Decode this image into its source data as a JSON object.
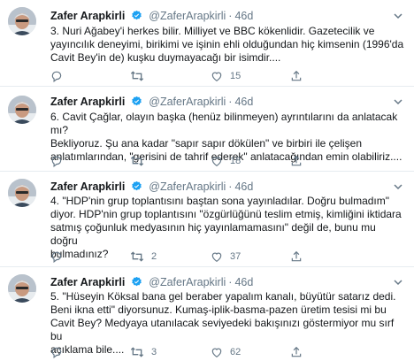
{
  "author": {
    "name": "Zafer Arapkirli",
    "handle": "@ZaferArapkirli",
    "verified": true
  },
  "tweets": [
    {
      "time": "46d",
      "text": "3. Nuri Ağabey'i herkes bilir. Milliyet ve BBC kökenlidir. Gazetecilik ve\nyayıncılık deneyimi, birikimi ve işinin ehli olduğundan hiç kimsenin (1996'da\nCavit Bey'in de) kuşku duymayacağı bir isimdir....",
      "replies": "",
      "retweets": "",
      "likes": "15"
    },
    {
      "time": "46d",
      "text": "6. Cavit Çağlar, olayın başka (henüz bilinmeyen) ayrıntılarını da anlatacak mı?\nBekliyoruz. Şu ana kadar \"sapır sapır dökülen\" ve birbiri ile çelişen\nanlatımlarından, \"gerisini de tahrif ederek\" anlatacağından emin olabiliriz....",
      "replies": "",
      "retweets": "",
      "likes": "18"
    },
    {
      "time": "46d",
      "text": "4. \"HDP'nin grup toplantısını baştan sona yayınladılar. Doğru bulmadım\"\ndiyor. HDP'nin grup toplantısını \"özgürlüğünü teslim etmiş, kimliğini iktidara\nsatmış çoğunluk medyasının hiç yayınlamamasını\" değil de, bunu mu doğru\nbulmadınız?",
      "replies": "",
      "retweets": "2",
      "likes": "37"
    },
    {
      "time": "46d",
      "text": "5. \"Hüseyin Köksal bana gel beraber yapalım kanalı, büyütür satarız dedi.\nBeni ikna etti\" diyorsunuz. Kumaş-iplik-basma-pazen üretim tesisi mi bu\nCavit Bey? Medyaya utanılacak seviyedeki bakışınızı göstermiyor mu sırf bu\naçıklama bile....",
      "replies": "",
      "retweets": "3",
      "likes": "62"
    }
  ],
  "icons": {
    "reply": "reply-icon",
    "retweet": "retweet-icon",
    "like": "heart-icon",
    "share": "share-icon",
    "caret": "chevron-down-icon",
    "verified": "verified-badge-icon"
  },
  "colors": {
    "verified": "#1da1f2",
    "muted": "#657786",
    "divider": "#e6ecf0"
  }
}
